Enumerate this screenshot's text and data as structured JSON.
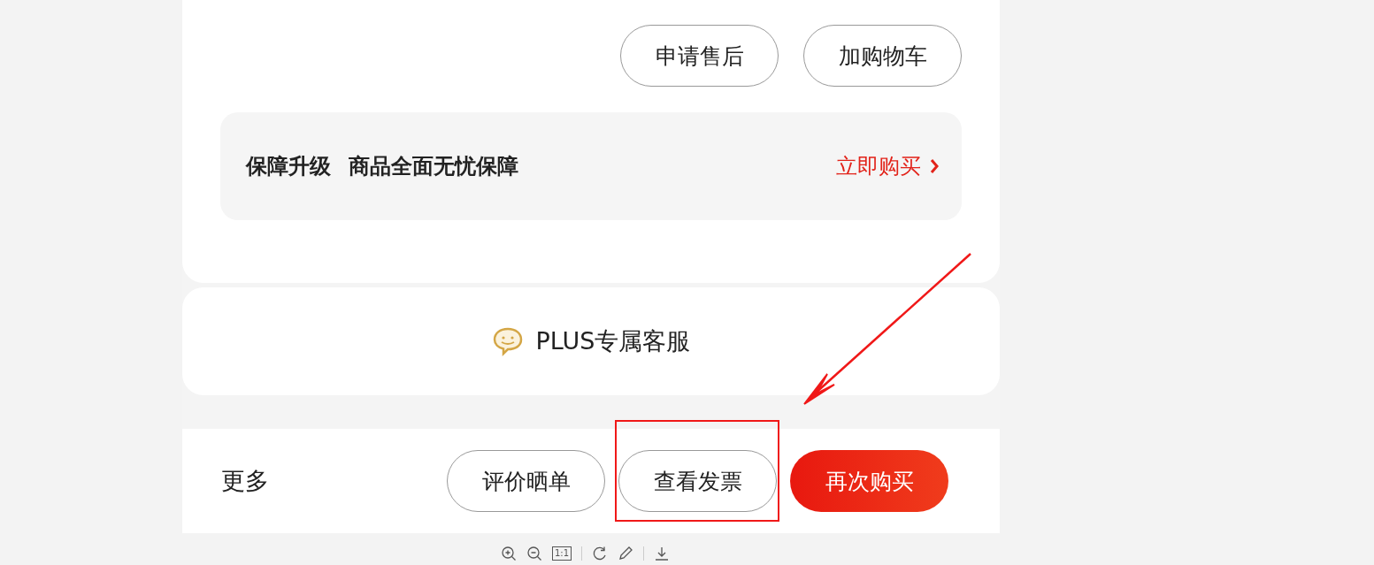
{
  "order_actions": [
    "申请售后",
    "加购物车"
  ],
  "protection": {
    "title": "保障升级",
    "description": "商品全面无忧保障",
    "link": "立即购买"
  },
  "service": {
    "label": "PLUS专属客服"
  },
  "bottom_bar": {
    "more": "更多",
    "buttons": [
      {
        "label": "评价晒单",
        "kind": "outline"
      },
      {
        "label": "查看发票",
        "kind": "outline"
      },
      {
        "label": "再次购买",
        "kind": "primary"
      }
    ]
  },
  "viewer_toolbar": {
    "reset_label": "1:1"
  }
}
